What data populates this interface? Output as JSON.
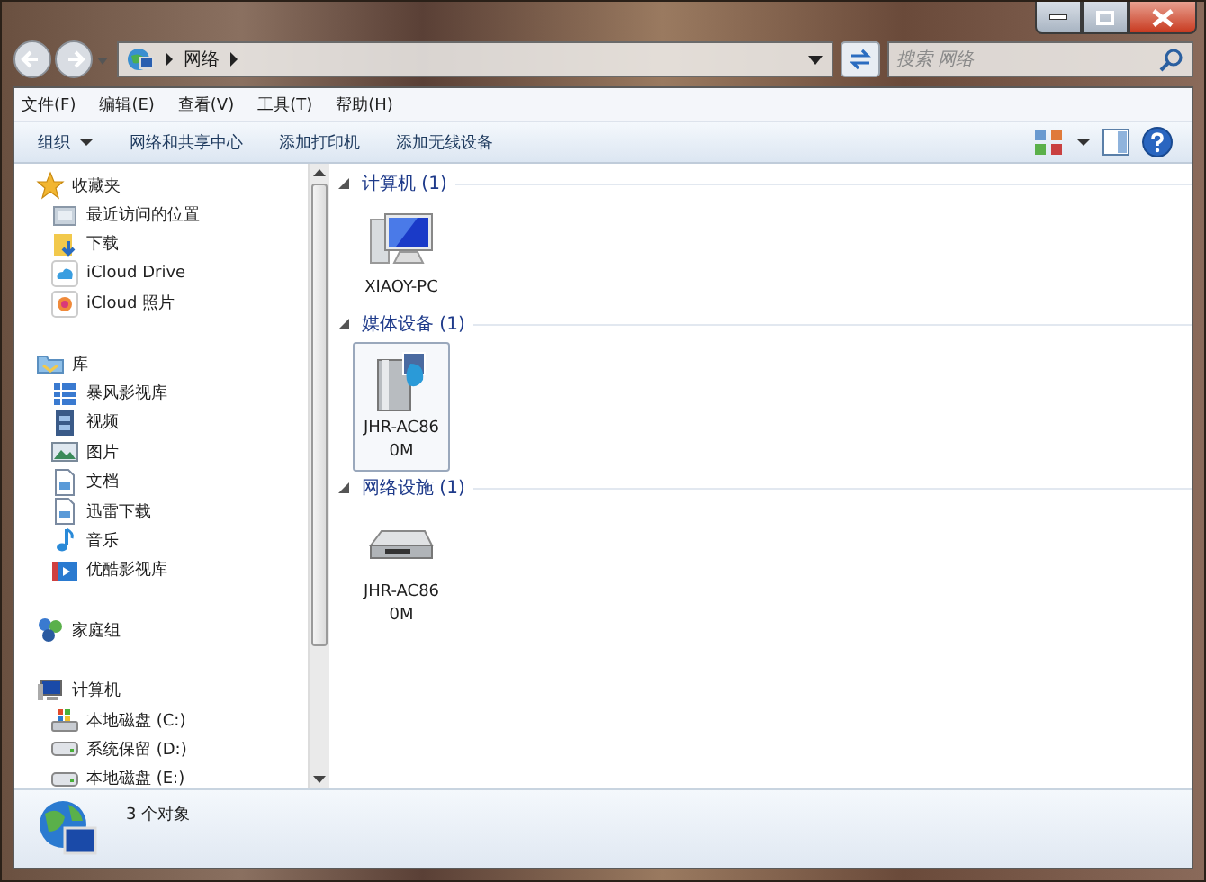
{
  "window": {
    "controls": [
      {
        "kind": "minimize"
      },
      {
        "kind": "maximize"
      },
      {
        "kind": "close"
      }
    ]
  },
  "address": {
    "path": [
      "网络"
    ]
  },
  "search": {
    "placeholder": "搜索 网络"
  },
  "menu": [
    "文件(F)",
    "编辑(E)",
    "查看(V)",
    "工具(T)",
    "帮助(H)"
  ],
  "toolbar": [
    {
      "label": "组织",
      "dropdown": true
    },
    {
      "label": "网络和共享中心",
      "dropdown": false
    },
    {
      "label": "添加打印机",
      "dropdown": false
    },
    {
      "label": "添加无线设备",
      "dropdown": false
    }
  ],
  "sidebar": {
    "groups": [
      {
        "label": "收藏夹",
        "kind": "star",
        "items": [
          {
            "label": "最近访问的位置",
            "kind": "recent"
          },
          {
            "label": "下载",
            "kind": "download"
          },
          {
            "label": "iCloud Drive",
            "kind": "cloud"
          },
          {
            "label": "iCloud 照片",
            "kind": "photos"
          }
        ]
      },
      {
        "label": "库",
        "kind": "library",
        "items": [
          {
            "label": "暴风影视库",
            "kind": "grid"
          },
          {
            "label": "视频",
            "kind": "video"
          },
          {
            "label": "图片",
            "kind": "picture"
          },
          {
            "label": "文档",
            "kind": "document"
          },
          {
            "label": "迅雷下载",
            "kind": "document"
          },
          {
            "label": "音乐",
            "kind": "music"
          },
          {
            "label": "优酷影视库",
            "kind": "video2"
          }
        ]
      },
      {
        "label": "家庭组",
        "kind": "homegroup"
      },
      {
        "label": "计算机",
        "kind": "computer",
        "items": [
          {
            "label": "本地磁盘 (C:)",
            "kind": "windrive"
          },
          {
            "label": "系统保留 (D:)",
            "kind": "drive"
          },
          {
            "label": "本地磁盘 (E:)",
            "kind": "drive"
          }
        ]
      }
    ]
  },
  "groups": [
    {
      "title": "计算机 (1)",
      "expanded": true,
      "items": [
        {
          "label": "XIAOY-PC",
          "kind": "computer",
          "selected": false
        }
      ]
    },
    {
      "title": "媒体设备 (1)",
      "expanded": true,
      "items": [
        {
          "label": "JHR-AC860M",
          "kind": "media",
          "selected": true
        }
      ]
    },
    {
      "title": "网络设施 (1)",
      "expanded": true,
      "items": [
        {
          "label": "JHR-AC860M",
          "kind": "router",
          "selected": false
        }
      ]
    }
  ],
  "status_bar": {
    "text": "3 个对象"
  }
}
